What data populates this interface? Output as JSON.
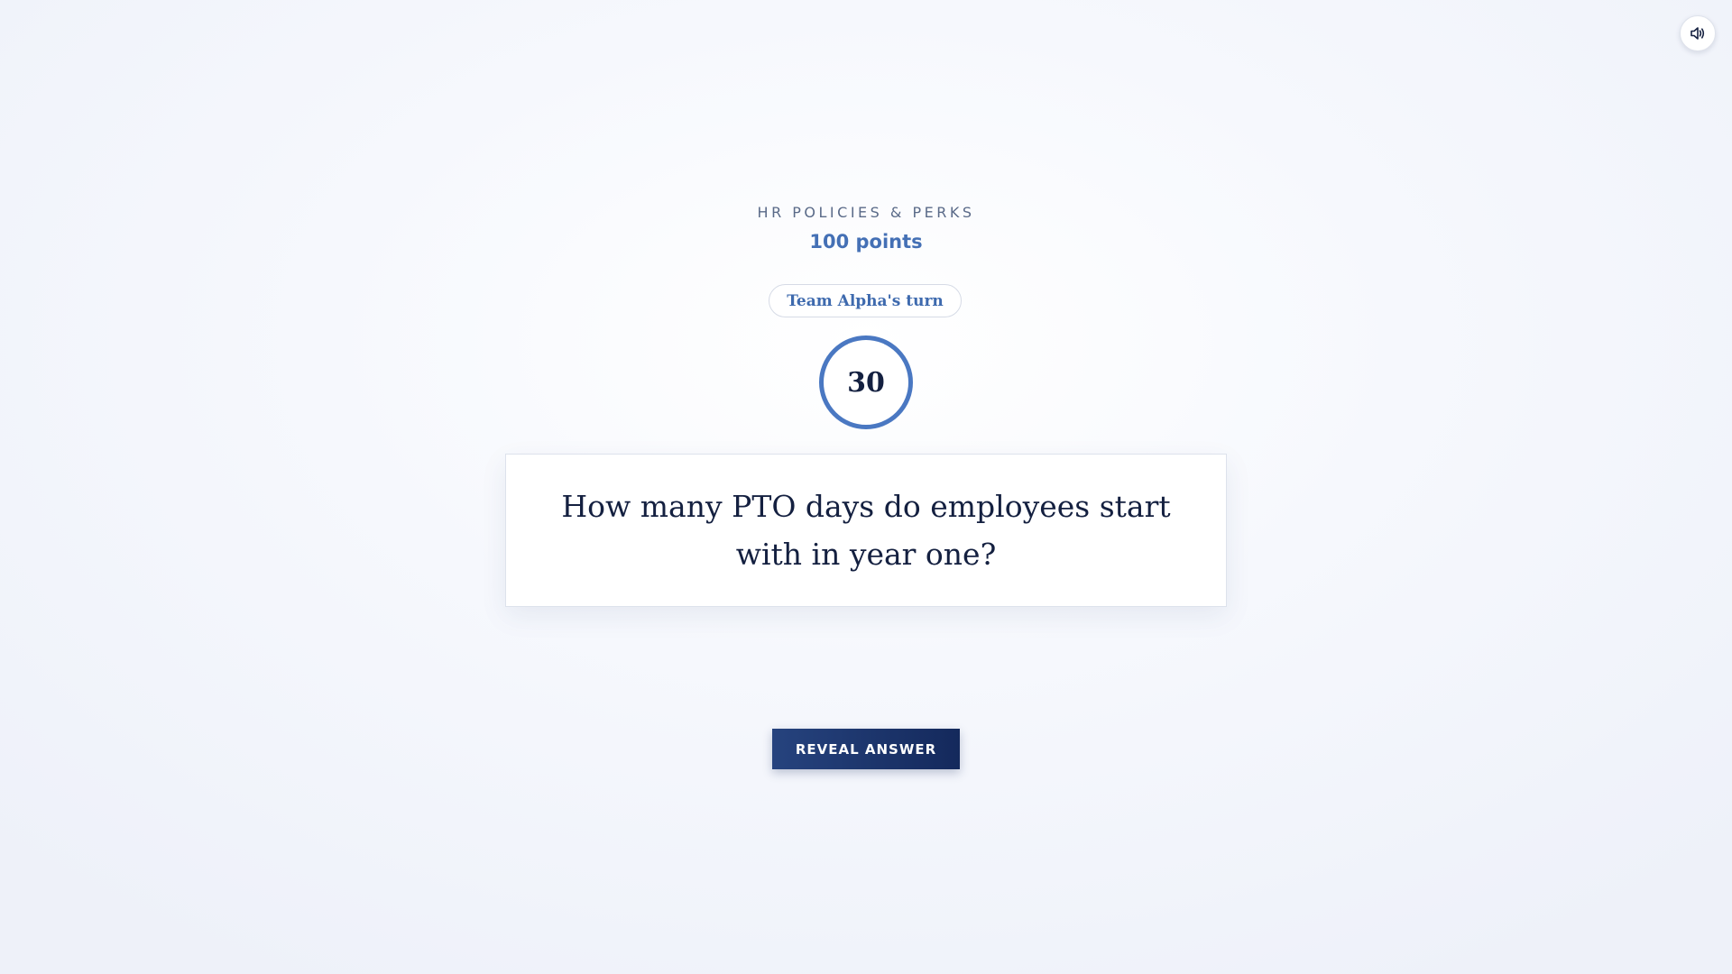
{
  "header": {
    "sound_icon": "speaker-volume-icon"
  },
  "question": {
    "category": "HR POLICIES & PERKS",
    "points": "100 points",
    "turn": "Team Alpha's turn",
    "timer": "30",
    "text": "How many PTO days do employees start with in year one?"
  },
  "actions": {
    "reveal_label": "REVEAL ANSWER"
  },
  "colors": {
    "accent": "#4a78c2",
    "button": "#1b3368",
    "text": "#142040"
  }
}
